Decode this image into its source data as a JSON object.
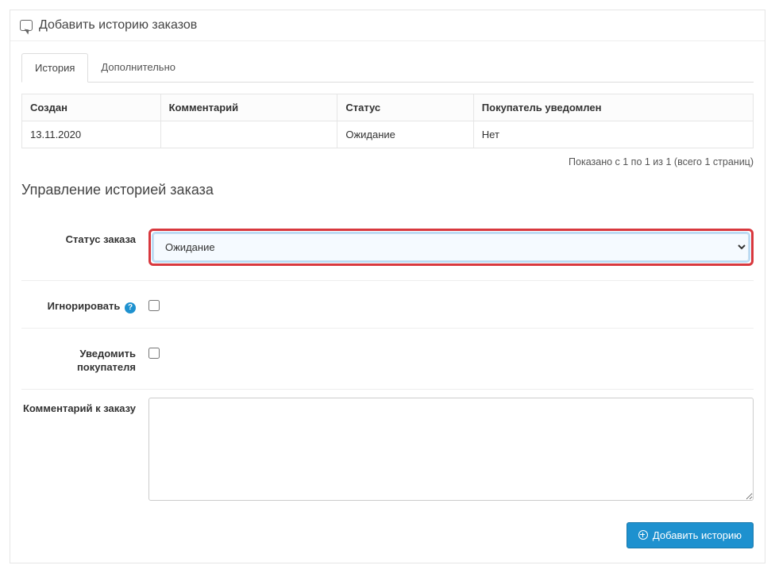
{
  "panel": {
    "title": "Добавить историю заказов"
  },
  "tabs": {
    "history": "История",
    "additional": "Дополнительно"
  },
  "table": {
    "headers": {
      "created": "Создан",
      "comment": "Комментарий",
      "status": "Статус",
      "notified": "Покупатель уведомлен"
    },
    "rows": [
      {
        "created": "13.11.2020",
        "comment": "",
        "status": "Ожидание",
        "notified": "Нет"
      }
    ]
  },
  "pagination": "Показано с 1 по 1 из 1 (всего 1 страниц)",
  "section_title": "Управление историей заказа",
  "form": {
    "status_label": "Статус заказа",
    "status_value": "Ожидание",
    "ignore_label": "Игнорировать",
    "help_icon": "?",
    "notify_label": "Уведомить покупателя",
    "comment_label": "Комментарий к заказу",
    "submit_label": "Добавить историю"
  }
}
